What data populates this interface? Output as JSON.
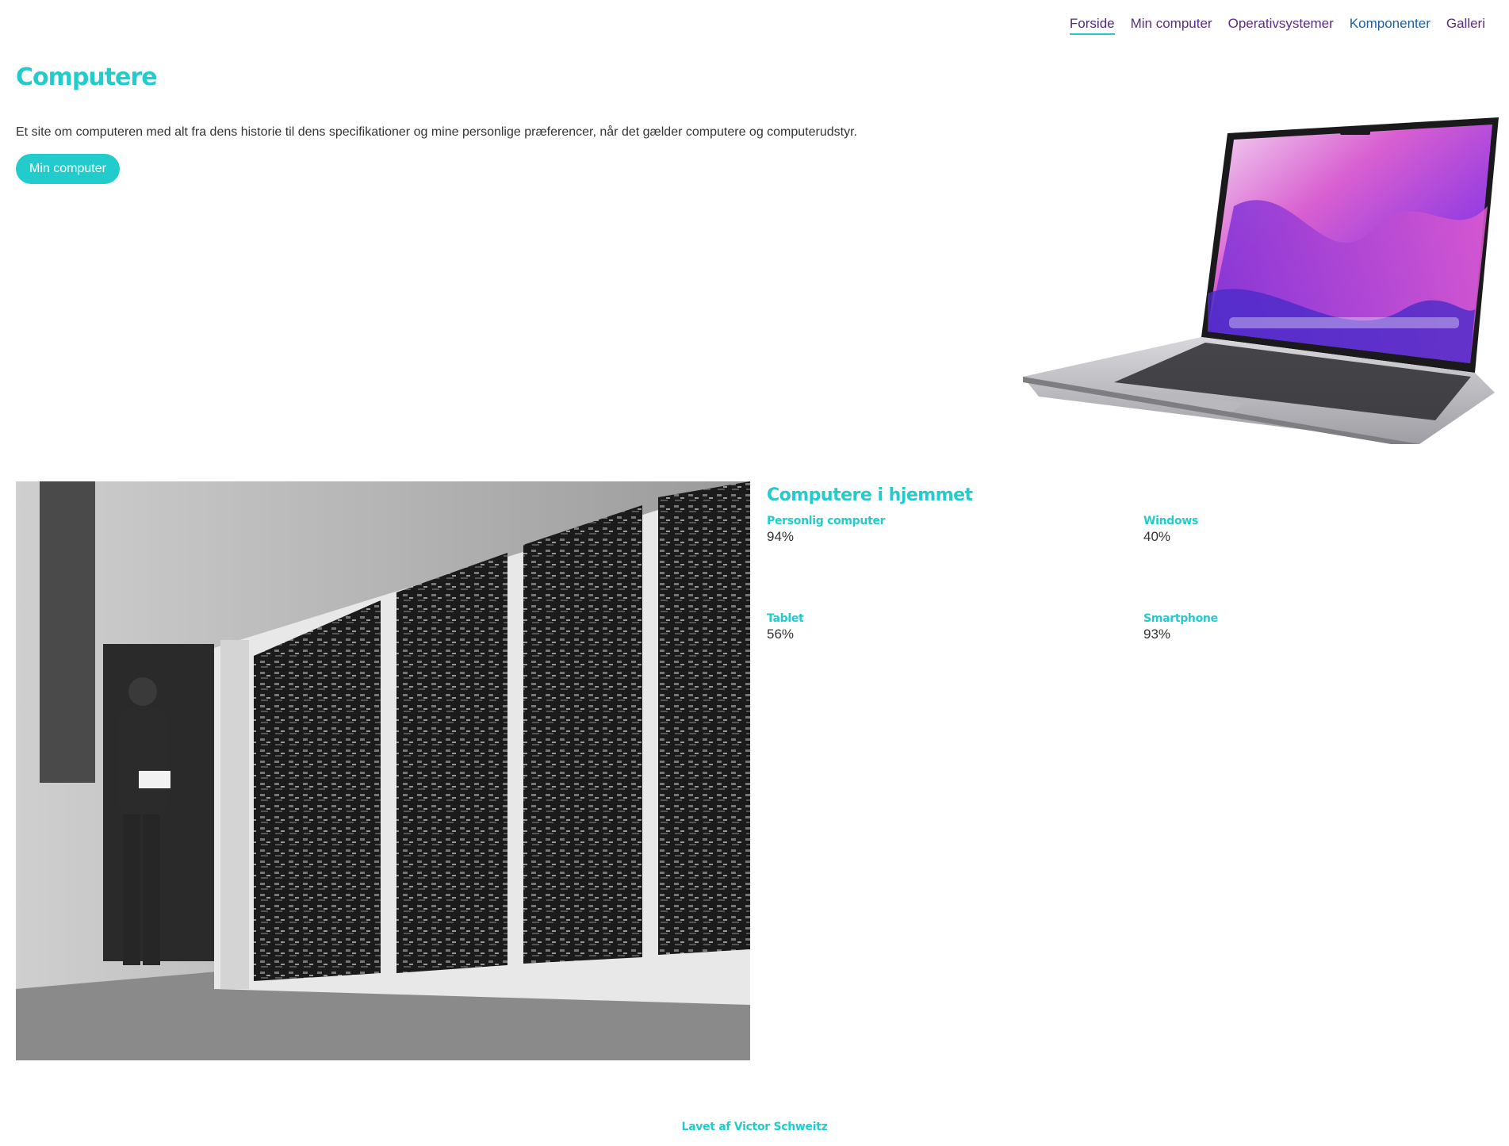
{
  "nav": {
    "items": [
      {
        "label": "Forside",
        "active": true
      },
      {
        "label": "Min computer",
        "active": false
      },
      {
        "label": "Operativsystemer",
        "active": false
      },
      {
        "label": "Komponenter",
        "active": false
      },
      {
        "label": "Galleri",
        "active": false
      }
    ]
  },
  "hero": {
    "title": "Computere",
    "text": "Et site om computeren med alt fra dens historie til dens specifikationer og mine personlige præferencer, når det gælder computere og computerudstyr.",
    "button_label": "Min computer"
  },
  "stats": {
    "title": "Computere i hjemmet",
    "items": [
      {
        "label": "Personlig computer",
        "value": "94%"
      },
      {
        "label": "Windows",
        "value": "40%"
      },
      {
        "label": "Tablet",
        "value": "56%"
      },
      {
        "label": "Smartphone",
        "value": "93%"
      }
    ]
  },
  "footer": {
    "text": "Lavet af Victor Schweitz"
  },
  "colors": {
    "accent": "#22cccc",
    "nav_text": "#5a2d82",
    "button_bg": "#22cccc"
  }
}
